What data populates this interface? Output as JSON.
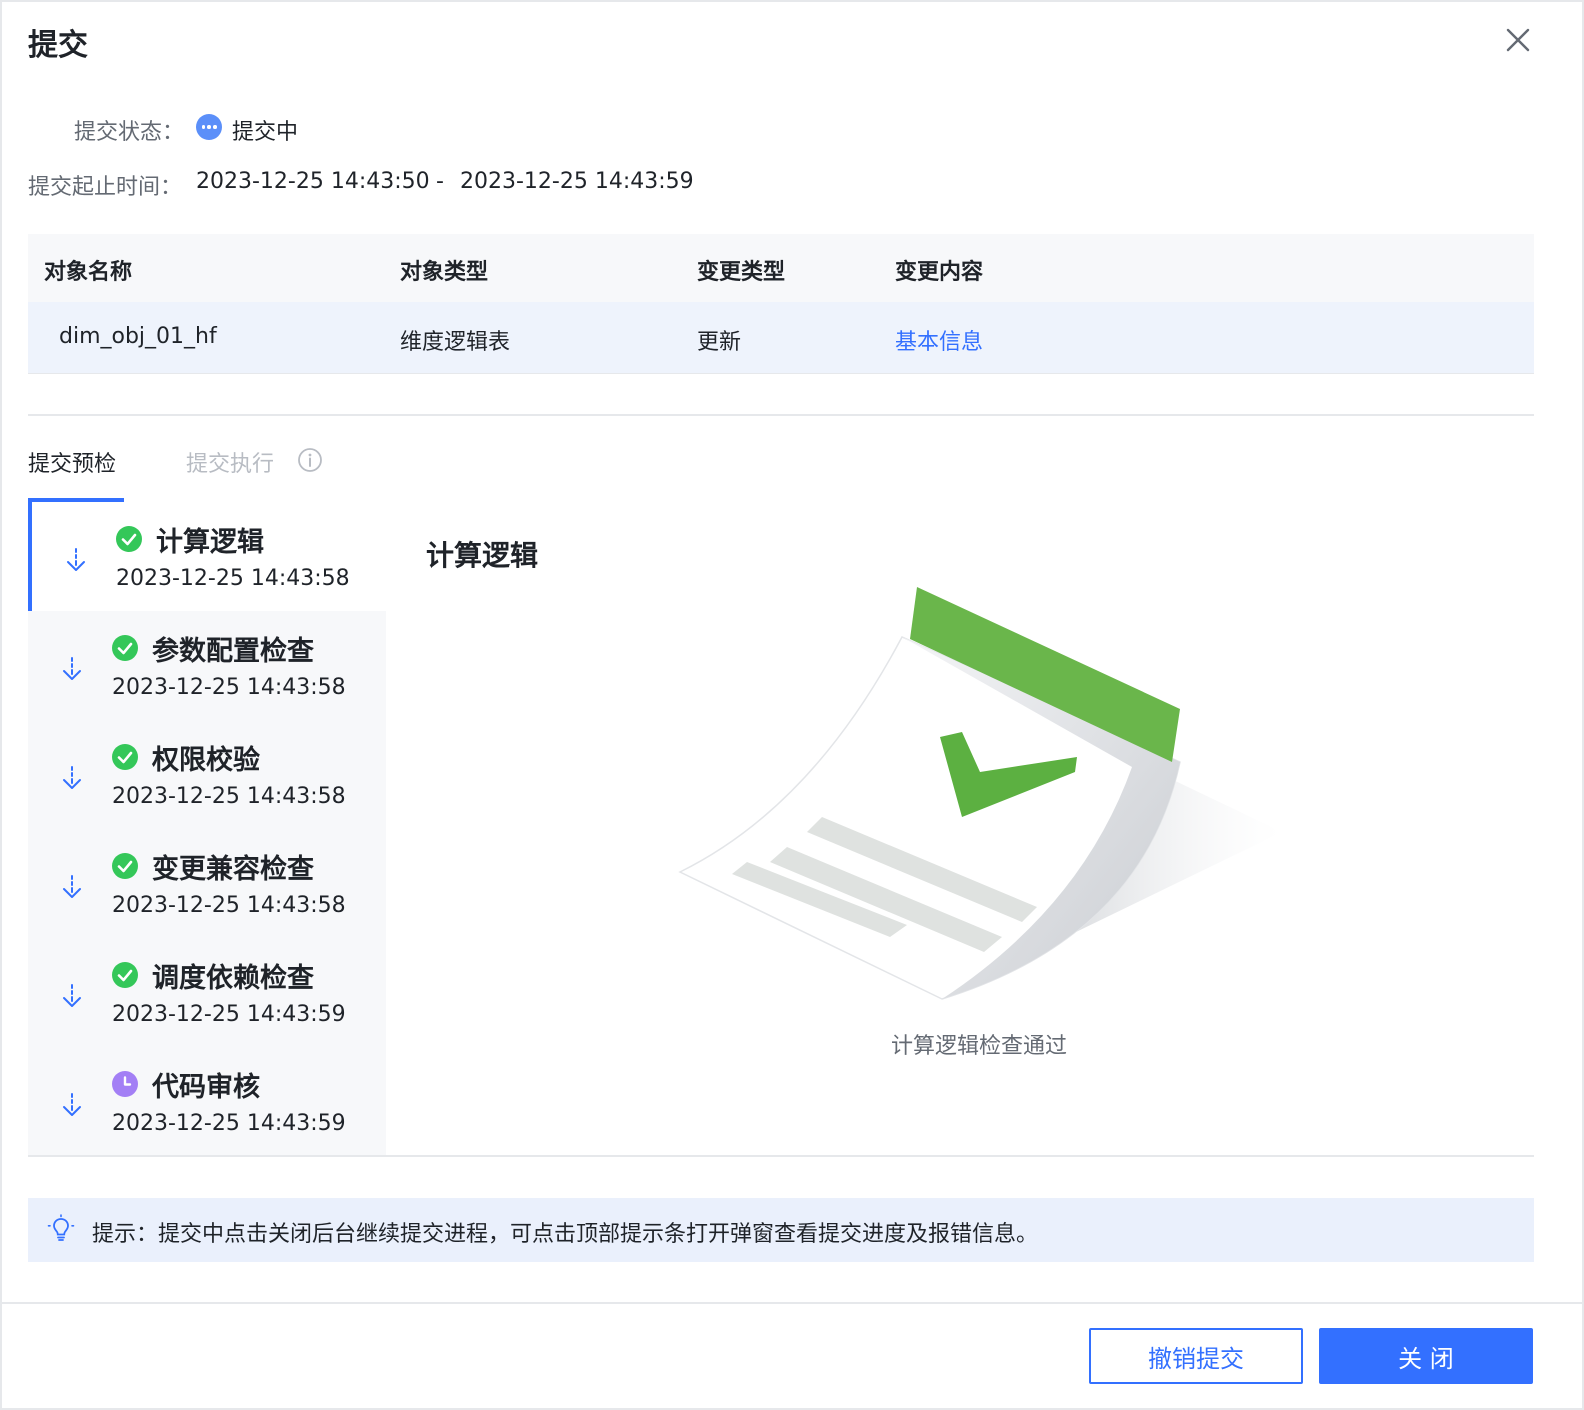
{
  "dialog": {
    "title": "提交",
    "close_icon": "close-icon"
  },
  "submission": {
    "status_label": "提交状态：",
    "status_value": "提交中",
    "time_label": "提交起止时间：",
    "start_time": "2023-12-25 14:43:50",
    "separator": "-",
    "end_time": "2023-12-25 14:43:59"
  },
  "table": {
    "headers": [
      "对象名称",
      "对象类型",
      "变更类型",
      "变更内容"
    ],
    "rows": [
      {
        "name": "dim_obj_01_hf",
        "type": "维度逻辑表",
        "change_type": "更新",
        "change_content": "基本信息"
      }
    ]
  },
  "tabs": {
    "precheck": "提交预检",
    "execute": "提交执行",
    "execute_info_icon": "info-icon"
  },
  "steps": [
    {
      "title": "计算逻辑",
      "time": "2023-12-25 14:43:58",
      "status": "success",
      "active": true
    },
    {
      "title": "参数配置检查",
      "time": "2023-12-25 14:43:58",
      "status": "success",
      "active": false
    },
    {
      "title": "权限校验",
      "time": "2023-12-25 14:43:58",
      "status": "success",
      "active": false
    },
    {
      "title": "变更兼容检查",
      "time": "2023-12-25 14:43:58",
      "status": "success",
      "active": false
    },
    {
      "title": "调度依赖检查",
      "time": "2023-12-25 14:43:59",
      "status": "success",
      "active": false
    },
    {
      "title": "代码审核",
      "time": "2023-12-25 14:43:59",
      "status": "pending",
      "active": false
    }
  ],
  "detail": {
    "title": "计算逻辑",
    "message": "计算逻辑检查通过",
    "illustration": "document-check-illustration"
  },
  "tip": {
    "icon": "lightbulb-icon",
    "text": "提示：提交中点击关闭后台继续提交进程，可点击顶部提示条打开弹窗查看提交进度及报错信息。"
  },
  "footer": {
    "cancel_label": "撤销提交",
    "close_label": "关 闭"
  },
  "colors": {
    "primary": "#3370ff",
    "success": "#34c759",
    "pending": "#a37ff5",
    "status_dot": "#5b8ff9"
  }
}
